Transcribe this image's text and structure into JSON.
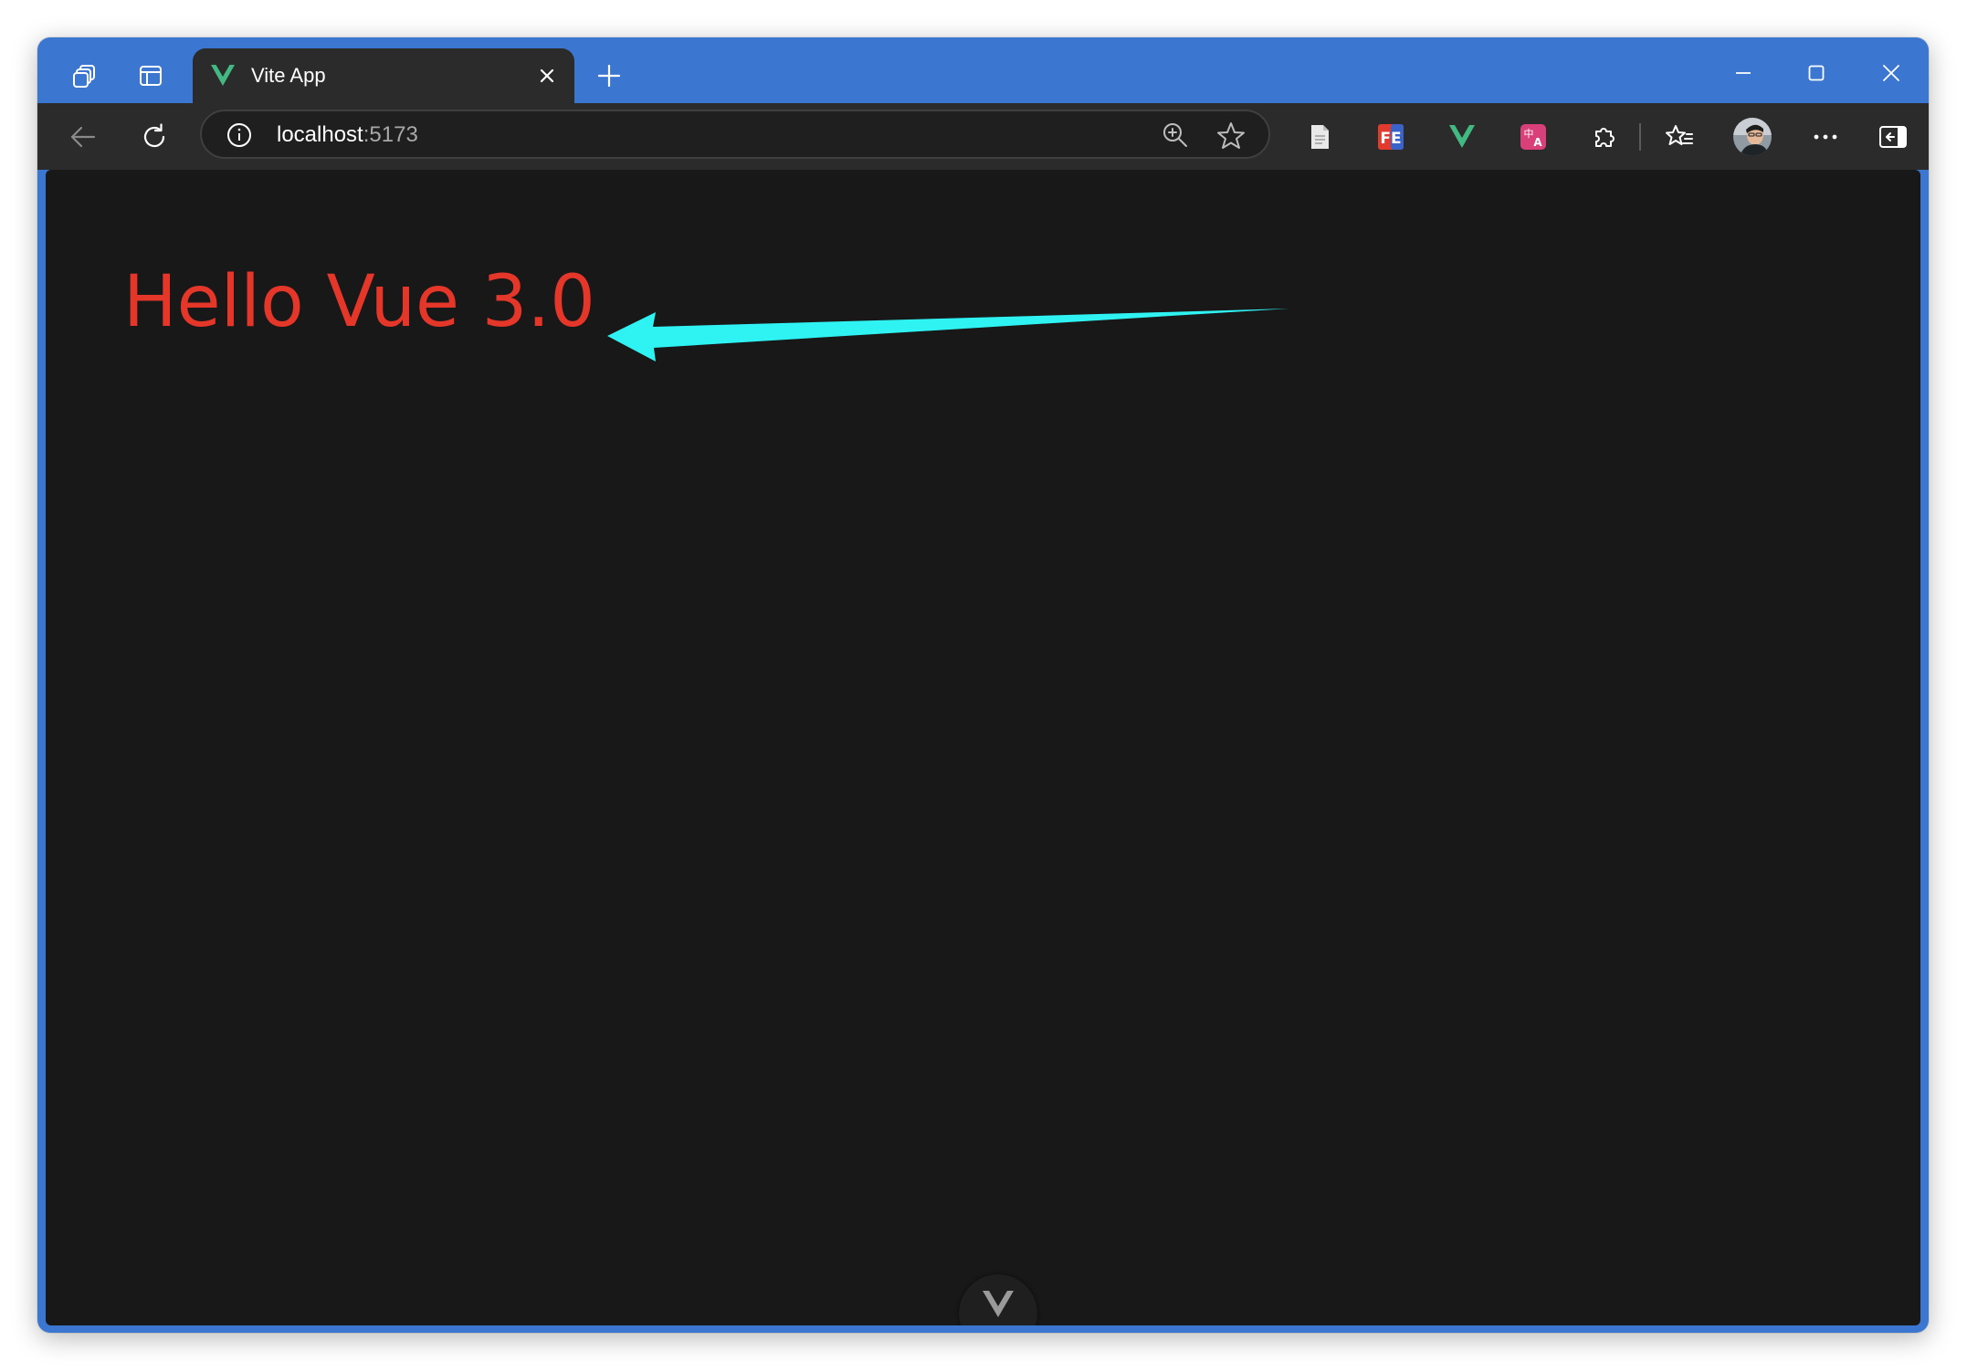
{
  "tab": {
    "title": "Vite App",
    "favicon": "vue-logo-icon"
  },
  "address_bar": {
    "host": "localhost",
    "port": ":5173"
  },
  "toolbar": {
    "extensions": [
      "page-icon",
      "fe-helper-icon",
      "vue-devtools-icon",
      "translate-icon",
      "extensions-puzzle-icon"
    ],
    "buttons": [
      "favorites-icon",
      "profile-avatar",
      "more-icon",
      "sidebar-toggle-icon"
    ]
  },
  "page": {
    "heading": "Hello Vue 3.0",
    "heading_color": "#e5362a",
    "annotation_arrow_color": "#2ff3f3",
    "background": "#181818"
  },
  "colors": {
    "titlebar": "#3b76d1",
    "toolbar": "#2b2b2b",
    "vue_green": "#42b883"
  }
}
